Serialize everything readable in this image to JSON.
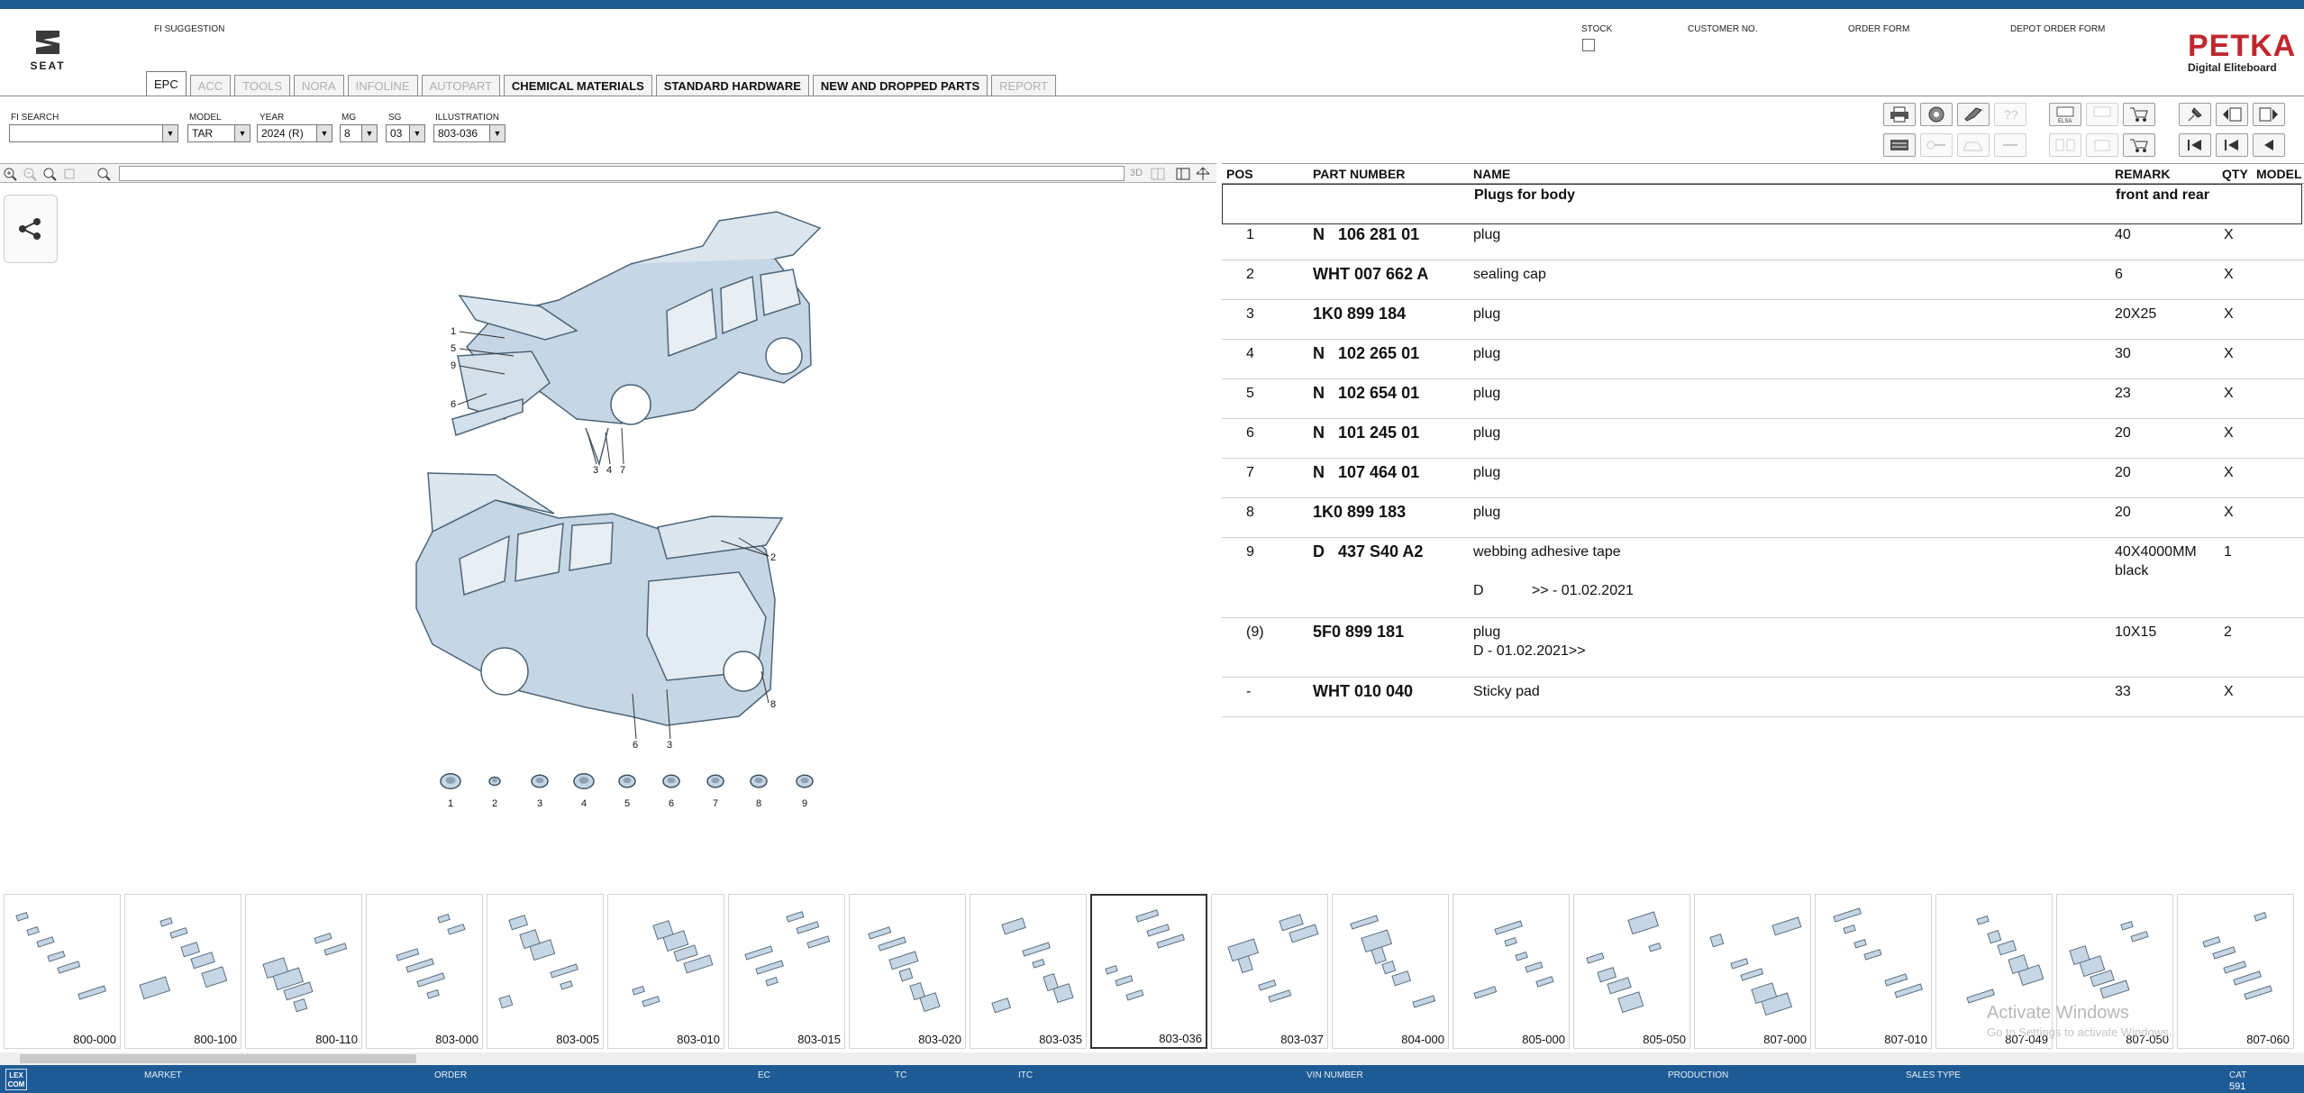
{
  "header": {
    "fi_suggestion": "FI SUGGESTION",
    "stock": "STOCK",
    "customer_no": "CUSTOMER NO.",
    "order_form": "ORDER FORM",
    "depot_order_form": "DEPOT ORDER FORM",
    "seat_logo_text": "SEAT",
    "petka_brand": "PETKA",
    "petka_sub": "Digital Eliteboard"
  },
  "tabs": [
    {
      "label": "EPC",
      "state": "active"
    },
    {
      "label": "ACC",
      "state": "disabled"
    },
    {
      "label": "TOOLS",
      "state": "disabled"
    },
    {
      "label": "NORA",
      "state": "disabled"
    },
    {
      "label": "INFOLINE",
      "state": "disabled"
    },
    {
      "label": "AUTOPART",
      "state": "disabled"
    },
    {
      "label": "CHEMICAL MATERIALS",
      "state": "enabled"
    },
    {
      "label": "STANDARD HARDWARE",
      "state": "enabled"
    },
    {
      "label": "NEW AND DROPPED PARTS",
      "state": "enabled"
    },
    {
      "label": "REPORT",
      "state": "disabled"
    }
  ],
  "filters": {
    "fi_search_label": "FI SEARCH",
    "fi_search_value": "",
    "model_label": "MODEL",
    "model_value": "TAR",
    "year_label": "YEAR",
    "year_value": "2024 (R)",
    "mg_label": "MG",
    "mg_value": "8",
    "sg_label": "SG",
    "sg_value": "03",
    "illustration_label": "ILLUSTRATION",
    "illustration_value": "803-036"
  },
  "viewer_toolbar": {
    "mode_3d": "3D"
  },
  "illustration": {
    "callouts": [
      "1",
      "5",
      "9",
      "6",
      "3",
      "4",
      "7",
      "2",
      "8",
      "6",
      "3"
    ],
    "part_icons": [
      "1",
      "2",
      "3",
      "4",
      "5",
      "6",
      "7",
      "8",
      "9"
    ]
  },
  "table": {
    "headers": {
      "pos": "POS",
      "part_number": "PART NUMBER",
      "name": "NAME",
      "remark": "REMARK",
      "qty": "QTY",
      "model": "MODEL"
    },
    "group": {
      "name": "Plugs for body",
      "remark": "front and rear"
    },
    "rows": [
      {
        "pos": "1",
        "part": "N   106 281 01",
        "name": "plug",
        "remark": "40",
        "qty": "X",
        "extra_name": "",
        "remark2": ""
      },
      {
        "pos": "2",
        "part": "WHT 007 662 A",
        "name": "sealing cap",
        "remark": "6",
        "qty": "X",
        "extra_name": "",
        "remark2": ""
      },
      {
        "pos": "3",
        "part": "1K0 899 184",
        "name": "plug",
        "remark": "20X25",
        "qty": "X",
        "extra_name": "",
        "remark2": ""
      },
      {
        "pos": "4",
        "part": "N   102 265 01",
        "name": "plug",
        "remark": "30",
        "qty": "X",
        "extra_name": "",
        "remark2": ""
      },
      {
        "pos": "5",
        "part": "N   102 654 01",
        "name": "plug",
        "remark": "23",
        "qty": "X",
        "extra_name": "",
        "remark2": ""
      },
      {
        "pos": "6",
        "part": "N   101 245 01",
        "name": "plug",
        "remark": "20",
        "qty": "X",
        "extra_name": "",
        "remark2": ""
      },
      {
        "pos": "7",
        "part": "N   107 464 01",
        "name": "plug",
        "remark": "20",
        "qty": "X",
        "extra_name": "",
        "remark2": ""
      },
      {
        "pos": "8",
        "part": "1K0 899 183",
        "name": "plug",
        "remark": "20",
        "qty": "X",
        "extra_name": "",
        "remark2": ""
      },
      {
        "pos": "9",
        "part": "D   437 S40 A2",
        "name": "webbing adhesive tape",
        "remark": "40X4000MM",
        "qty": "1",
        "extra_name": "D            >> - 01.02.2021",
        "remark2": "black"
      },
      {
        "pos": "(9)",
        "part": "5F0 899 181",
        "name": "plug",
        "remark": "10X15",
        "qty": "2",
        "extra_name": "D - 01.02.2021>>",
        "remark2": ""
      },
      {
        "pos": "-",
        "part": "WHT 010 040",
        "name": "Sticky pad",
        "remark": "33",
        "qty": "X",
        "extra_name": "",
        "remark2": ""
      }
    ]
  },
  "thumbnails": [
    "800-000",
    "800-100",
    "800-110",
    "803-000",
    "803-005",
    "803-010",
    "803-015",
    "803-020",
    "803-035",
    "803-036",
    "803-037",
    "804-000",
    "805-000",
    "805-050",
    "807-000",
    "807-010",
    "807-049",
    "807-050",
    "807-060"
  ],
  "selected_thumbnail": "803-036",
  "watermark": {
    "line1": "Activate Windows",
    "line2": "Go to Settings to activate Windows."
  },
  "status_bar": {
    "market": "MARKET",
    "order": "ORDER",
    "ec": "EC",
    "tc": "TC",
    "itc": "ITC",
    "vin": "VIN NUMBER",
    "production": "PRODUCTION",
    "sales_type": "SALES TYPE",
    "cat": "CAT",
    "cat_value": "591",
    "logo": "LEX COM"
  },
  "colors": {
    "brand_blue": "#1f5b93",
    "status_blue": "#1e5b95",
    "petka_red": "#c0272d",
    "part_fill": "#c6d6e4",
    "part_stroke": "#4d6578"
  }
}
